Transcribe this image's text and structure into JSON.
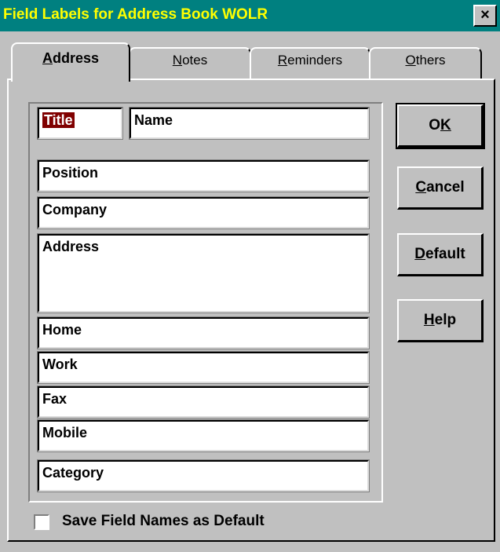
{
  "window": {
    "title": "Field Labels for Address Book WOLR",
    "close_glyph": "×"
  },
  "tabs": [
    {
      "label": "Address",
      "mnemonic": "A",
      "rest": "ddress",
      "active": true
    },
    {
      "label": "Notes",
      "mnemonic": "N",
      "rest": "otes",
      "active": false
    },
    {
      "label": "Reminders",
      "mnemonic": "R",
      "rest": "eminders",
      "active": false
    },
    {
      "label": "Others",
      "mnemonic": "O",
      "rest": "thers",
      "active": false
    }
  ],
  "fields": {
    "title": "Title",
    "name": "Name",
    "position": "Position",
    "company": "Company",
    "address": "Address",
    "home": "Home",
    "work": "Work",
    "fax": "Fax",
    "mobile": "Mobile",
    "category": "Category"
  },
  "buttons": {
    "ok": {
      "pre": "O",
      "mnemonic": "K",
      "post": ""
    },
    "cancel": {
      "pre": "",
      "mnemonic": "C",
      "post": "ancel"
    },
    "default": {
      "pre": "",
      "mnemonic": "D",
      "post": "efault"
    },
    "help": {
      "pre": "",
      "mnemonic": "H",
      "post": "elp"
    }
  },
  "checkbox": {
    "label": "Save Field Names as Default",
    "checked": false
  },
  "colors": {
    "titlebar": "#008080",
    "title_text": "#ffff00",
    "face": "#c0c0c0",
    "selection": "#800000"
  }
}
